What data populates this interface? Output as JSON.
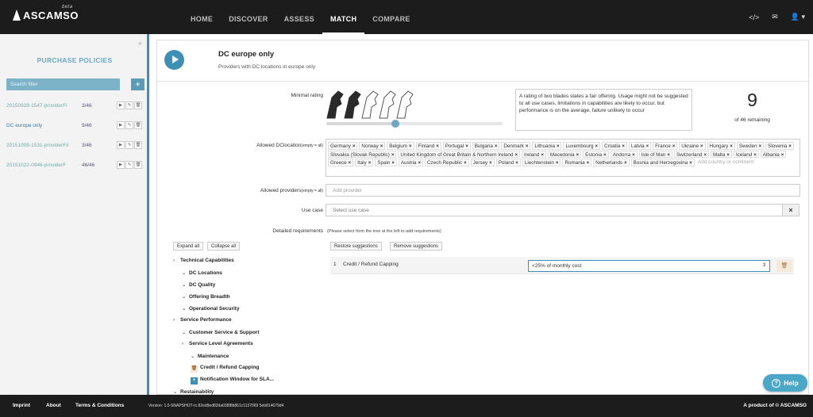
{
  "app": {
    "logo_text": "ASCAMSO",
    "logo_badge": "beta"
  },
  "nav": {
    "items": [
      {
        "label": "HOME",
        "active": false
      },
      {
        "label": "DISCOVER",
        "active": false
      },
      {
        "label": "ASSESS",
        "active": false
      },
      {
        "label": "MATCH",
        "active": true
      },
      {
        "label": "COMPARE",
        "active": false
      }
    ]
  },
  "top_icons": {
    "code": "</>",
    "mail": "✉",
    "user": "👤 ▾"
  },
  "sidebar": {
    "title": "PURCHASE POLICIES",
    "search_placeholder": "Search filter",
    "add_label": "+",
    "collapse_label": "«",
    "policies": [
      {
        "name": "20150928-1547-providerFi",
        "count": "3/46",
        "active": false
      },
      {
        "name": "DC europe only",
        "count": "9/46",
        "active": true
      },
      {
        "name": "20151009-1531-providerFil",
        "count": "3/46",
        "active": false
      },
      {
        "name": "20151022-0946-providerF",
        "count": "46/46",
        "active": false
      }
    ]
  },
  "policy": {
    "title": "DC europe only",
    "subtitle": "Providers with DC locations in europe only"
  },
  "rating": {
    "label": "Minimal rating",
    "value": 2,
    "max": 5,
    "description": "A rating of two blades states a fair offering. Usage might not be suggested to all use cases, limitations in capabilities are likely to occur, but performance is on the average, failure unlikely to occur",
    "remaining_count": "9",
    "remaining_text": "of 46 remaining"
  },
  "dc_location": {
    "label": "Allowed DClocation",
    "label_small": "(empty = all)",
    "tags": [
      "Germany",
      "Norway",
      "Belgium",
      "Finland",
      "Portugal",
      "Bulgaria",
      "Denmark",
      "Lithuania",
      "Luxembourg",
      "Croatia",
      "Latvia",
      "France",
      "Ukraine",
      "Hungary",
      "Sweden",
      "Slovenia",
      "Slovakia (Slovak Republic)",
      "United Kingdom of Great Britain & Northern Ireland",
      "Ireland",
      "Macedonia",
      "Estonia",
      "Andorra",
      "Isle of Man",
      "Switzerland",
      "Malta",
      "Iceland",
      "Albania",
      "Greece",
      "Italy",
      "Spain",
      "Austria",
      "Czech Republic",
      "Jersey",
      "Poland",
      "Liechtenstein",
      "Romania",
      "Netherlands",
      "Bosnia and Herzegovina"
    ],
    "placeholder": "Add country or continent"
  },
  "providers": {
    "label": "Allowed providers",
    "label_small": "(empty = all)",
    "placeholder": "Add provider"
  },
  "use_case": {
    "label": "Use case",
    "placeholder": "Select use case",
    "clear": "×"
  },
  "requirements": {
    "label": "Detailed requirements",
    "hint": "(Please select from the tree at the left to add requirements)",
    "expand_all": "Expand all",
    "collapse_all": "Collapse all",
    "restore": "Restore suggestions",
    "remove": "Remove suggestions",
    "tree": [
      {
        "label": "Technical Capabilities",
        "caret": "›"
      },
      {
        "label": "DC Locations",
        "caret": "⌄"
      },
      {
        "label": "DC Quality",
        "caret": "⌄"
      },
      {
        "label": "Offering Breadth",
        "caret": "⌄"
      },
      {
        "label": "Operational Security",
        "caret": "⌄"
      },
      {
        "label": "Service Performance",
        "caret": "›"
      },
      {
        "label": "Customer Service & Support",
        "caret": "⌄"
      },
      {
        "label": "Service Level Agreements",
        "caret": "›"
      },
      {
        "label": "Maintenance",
        "caret": "⌄"
      },
      {
        "label": "Credit / Refund Capping",
        "caret": "🗑"
      },
      {
        "label": "Notification Window for SLA...",
        "caret": "+"
      },
      {
        "label": "Restainability",
        "caret": "⌄"
      }
    ],
    "rows": [
      {
        "num": "1",
        "name": "Credit / Refund Capping",
        "value": "<25% of monthly cost"
      }
    ]
  },
  "footer": {
    "imprint": "Imprint",
    "about": "About",
    "terms": "Terms & Conditions",
    "version": "Version: 1.0-SNAPSHOT-rc.82ed9ed82da038f8b861c1137069 5eb814679d4",
    "product": "A product of © ASCAMSO"
  },
  "help": {
    "label": "Help",
    "icon": "?"
  },
  "colors": {
    "accent": "#3d8fb3",
    "dark": "#1c1c1c",
    "sidebar_bg": "#f3f3f3"
  }
}
